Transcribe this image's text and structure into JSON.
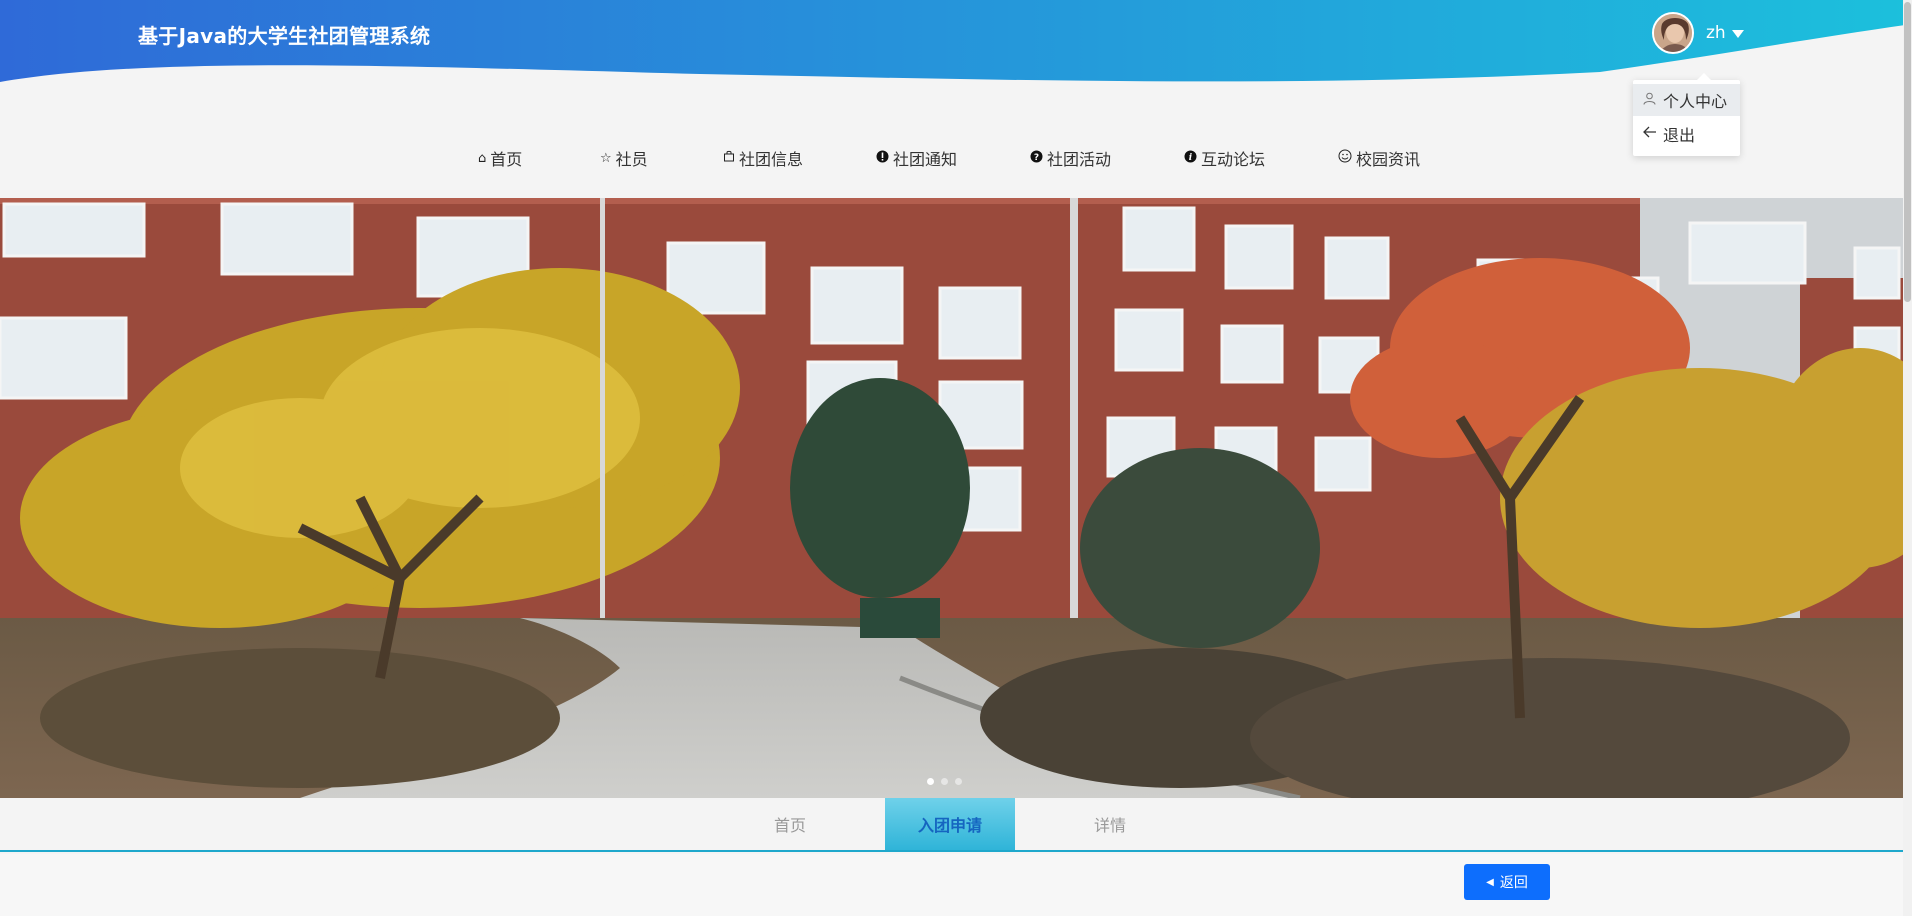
{
  "header": {
    "title": "基于Java的大学生社团管理系统",
    "username": "zh",
    "gradient_start": "#2f6ad8",
    "gradient_end": "#1cc0dc"
  },
  "user_menu": {
    "items": [
      {
        "icon": "user-icon",
        "label": "个人中心"
      },
      {
        "icon": "logout-icon",
        "label": "退出"
      }
    ]
  },
  "nav": {
    "items": [
      {
        "icon": "home-icon",
        "label": "首页"
      },
      {
        "icon": "star-icon",
        "label": "社员"
      },
      {
        "icon": "bag-icon",
        "label": "社团信息"
      },
      {
        "icon": "exclamation-icon",
        "label": "社团通知"
      },
      {
        "icon": "question-icon",
        "label": "社团活动"
      },
      {
        "icon": "info-icon",
        "label": "互动论坛"
      },
      {
        "icon": "smile-icon",
        "label": "校园资讯"
      }
    ]
  },
  "carousel": {
    "slide_count": 3,
    "active_index": 0
  },
  "tabs": {
    "items": [
      {
        "label": "首页"
      },
      {
        "label": "入团申请"
      },
      {
        "label": "详情"
      }
    ],
    "active_index": 1,
    "accent": "#1ea8cc"
  },
  "actions": {
    "back_label": "返回",
    "button_color": "#0d6efd"
  }
}
